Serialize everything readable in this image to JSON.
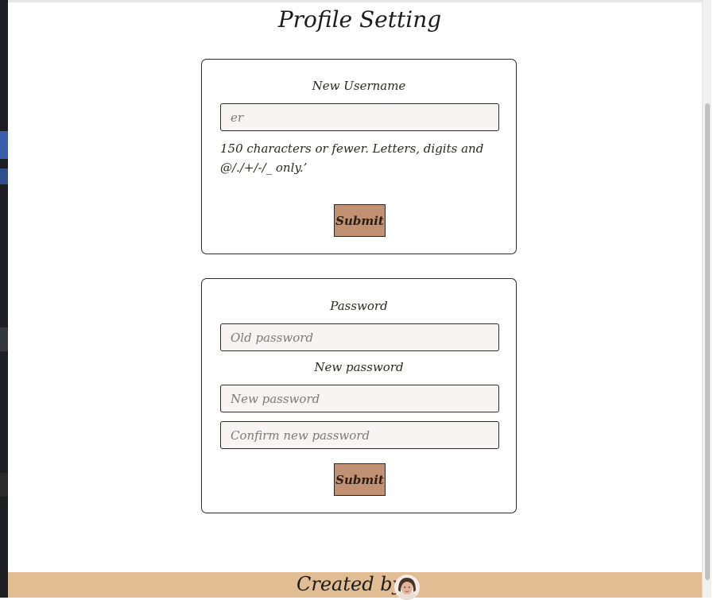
{
  "page": {
    "title": "Profile Setting"
  },
  "username_form": {
    "label": "New Username",
    "input_value": "",
    "input_placeholder": "er",
    "help_text": "150 characters or fewer. Letters, digits and @/./+/-/_ only.’",
    "submit_label": "Submit"
  },
  "password_form": {
    "old_label": "Password",
    "old_placeholder": "Old password",
    "new_label": "New password",
    "new_placeholder": "New password",
    "confirm_placeholder": "Confirm new password",
    "submit_label": "Submit"
  },
  "footer": {
    "created_by": "Created by:"
  },
  "colors": {
    "button": "#c29072",
    "footer": "#e2bd94",
    "input_bg": "#f8f4f3"
  }
}
